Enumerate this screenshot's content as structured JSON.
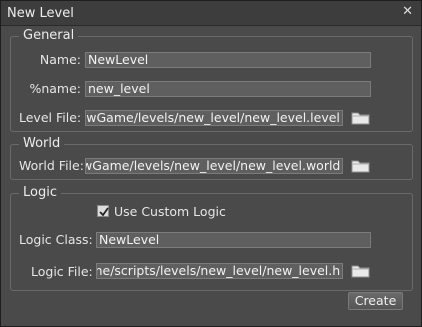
{
  "window": {
    "title": "New Level"
  },
  "general": {
    "legend": "General",
    "name_label": "Name:",
    "name_value": "NewLevel",
    "pname_label": "%name:",
    "pname_value": "new_level",
    "levelfile_label": "Level File:",
    "levelfile_value": "/NewGame/levels/new_level/new_level.level"
  },
  "world": {
    "legend": "World",
    "worldfile_label": "World File:",
    "worldfile_value": "NewGame/levels/new_level/new_level.world"
  },
  "logic": {
    "legend": "Logic",
    "use_custom_logic_label": "Use Custom Logic",
    "use_custom_logic_checked": true,
    "logicclass_label": "Logic Class:",
    "logicclass_value": "NewLevel",
    "logicfile_label": "Logic File:",
    "logicfile_value": "Game/scripts/levels/new_level/new_level.h"
  },
  "actions": {
    "create_label": "Create"
  },
  "icons": {
    "close": "close-icon",
    "browse": "folder-icon"
  }
}
